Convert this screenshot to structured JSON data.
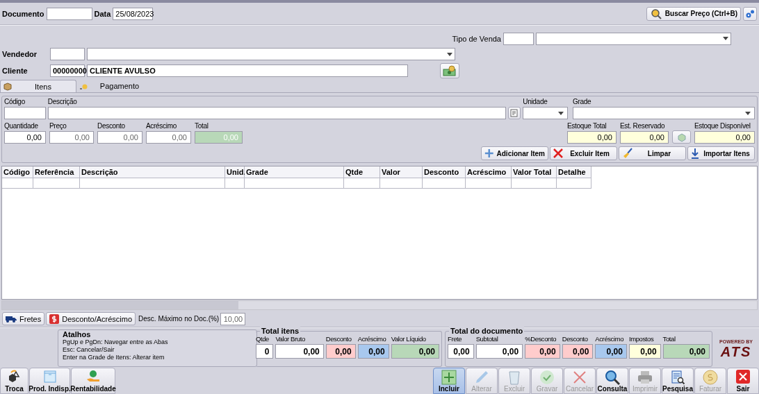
{
  "header": {
    "documento_label": "Documento",
    "data_label": "Data",
    "data_value": "25/08/2023",
    "buscar_button": "Buscar Preço (Ctrl+B)"
  },
  "tipo_venda_label": "Tipo de Venda",
  "vendedor_label": "Vendedor",
  "cliente": {
    "label": "Cliente",
    "code": "00000000",
    "name": "CLIENTE AVULSO"
  },
  "tabs": [
    {
      "label": "Itens",
      "selected": true
    },
    {
      "label": "Pagamento",
      "selected": false
    }
  ],
  "item_form": {
    "row1": [
      {
        "label": "Código",
        "kind": "text"
      },
      {
        "label": "Descrição",
        "kind": "text"
      },
      {
        "label": "Unidade",
        "kind": "select"
      },
      {
        "label": "Grade",
        "kind": "select"
      }
    ],
    "row2": [
      {
        "label": "Quantidade",
        "value": "0,00",
        "kind": "input"
      },
      {
        "label": "Preço",
        "value": "0,00",
        "kind": "readonly"
      },
      {
        "label": "Desconto",
        "value": "0,00",
        "kind": "readonly"
      },
      {
        "label": "Acréscimo",
        "value": "0,00",
        "kind": "readonly"
      },
      {
        "label": "Total",
        "value": "0,00",
        "kind": "green"
      }
    ],
    "stock": [
      {
        "label": "Estoque Total",
        "value": "0,00",
        "kind": "yellow"
      },
      {
        "label": "Est. Reservado",
        "value": "0,00",
        "kind": "yellow"
      },
      {
        "label": "Estoque Disponível",
        "value": "0,00",
        "kind": "yellow"
      }
    ],
    "buttons": [
      "Adicionar Item",
      "Excluir Item",
      "Limpar",
      "Importar Itens"
    ]
  },
  "table": {
    "columns": [
      "Código",
      "Referência",
      "Descrição",
      "Unid.",
      "Grade",
      "Qtde",
      "Valor",
      "Desconto",
      "Acréscimo",
      "Valor Total",
      "Detalhe"
    ]
  },
  "bottom_tabs": [
    "Fretes",
    "Desconto/Acréscimo"
  ],
  "desc_maximo": {
    "label": "Desc. Máximo no Doc.(%)",
    "value": "10,00"
  },
  "atalhos": {
    "title": "Atalhos",
    "lines": [
      "PgUp e PgDn: Navegar entre as Abas",
      "Esc: Cancelar/Sair",
      "Enter na Grade de Itens: Alterar item"
    ]
  },
  "total_itens": {
    "title": "Total itens",
    "fields": [
      {
        "label": "Qtde",
        "value": "0",
        "kind": "input"
      },
      {
        "label": "Valor Bruto",
        "value": "0,00",
        "kind": "input"
      },
      {
        "label": "Desconto",
        "value": "0,00",
        "kind": "pink"
      },
      {
        "label": "Acréscimo",
        "value": "0,00",
        "kind": "blue"
      },
      {
        "label": "Valor Líquido",
        "value": "0,00",
        "kind": "green"
      }
    ]
  },
  "total_documento": {
    "title": "Total do documento",
    "fields": [
      {
        "label": "Frete",
        "value": "0,00",
        "kind": "input"
      },
      {
        "label": "Subtotal",
        "value": "0,00",
        "kind": "input"
      },
      {
        "label": "%Desconto",
        "value": "0,00",
        "kind": "pink"
      },
      {
        "label": "Desconto",
        "value": "0,00",
        "kind": "pink"
      },
      {
        "label": "Acréscimo",
        "value": "0,00",
        "kind": "blue"
      },
      {
        "label": "Impostos",
        "value": "0,00",
        "kind": "yellow"
      },
      {
        "label": "Total",
        "value": "0,00",
        "kind": "green"
      }
    ]
  },
  "logo": {
    "tagline": "POWERED BY",
    "name": "ATS"
  },
  "left_tools": [
    "Troca",
    "Prod. Indisp.",
    "Rentabilidade"
  ],
  "right_tools": [
    {
      "label": "Incluir",
      "selected": true,
      "disabled": false
    },
    {
      "label": "Alterar",
      "selected": false,
      "disabled": true
    },
    {
      "label": "Excluir",
      "selected": false,
      "disabled": true
    },
    {
      "label": "Gravar",
      "selected": false,
      "disabled": true
    },
    {
      "label": "Cancelar",
      "selected": false,
      "disabled": true
    },
    {
      "label": "Consulta",
      "selected": false,
      "disabled": false
    },
    {
      "label": "Imprimir",
      "selected": false,
      "disabled": true
    },
    {
      "label": "Pesquisa",
      "selected": false,
      "disabled": false
    },
    {
      "label": "Faturar",
      "selected": false,
      "disabled": true
    },
    {
      "label": "Sair",
      "selected": false,
      "disabled": false
    }
  ]
}
